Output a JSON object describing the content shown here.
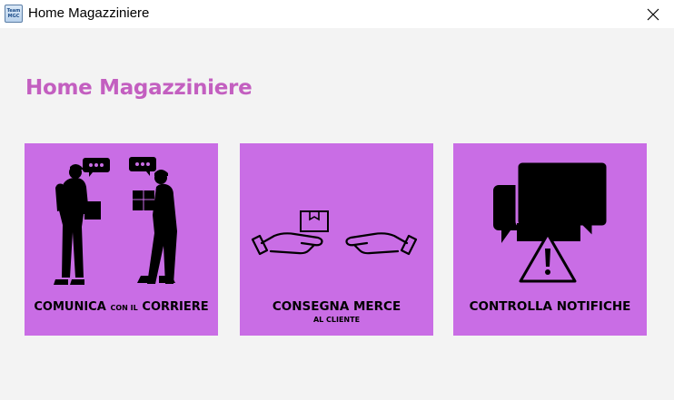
{
  "window": {
    "title": "Home Magazziniere",
    "icon_text_top": "Team",
    "icon_text_bottom": "MGC",
    "icon": "app-icon",
    "close_icon": "close-icon"
  },
  "page": {
    "title": "Home Magazziniere",
    "title_color": "#c35fc0"
  },
  "tiles": [
    {
      "id": "comunica",
      "label_parts": [
        "COMUNICA",
        "CON IL",
        "CORRIERE"
      ],
      "icon": "couriers-chat-icon",
      "color": "#c96de5"
    },
    {
      "id": "consegna",
      "label_main": "CONSEGNA MERCE",
      "label_sub": "AL CLIENTE",
      "icon": "hands-package-icon",
      "color": "#c96de5"
    },
    {
      "id": "notifiche",
      "label_main": "CONTROLLA NOTIFICHE",
      "icon": "chat-warning-icon",
      "color": "#c96de5"
    }
  ]
}
